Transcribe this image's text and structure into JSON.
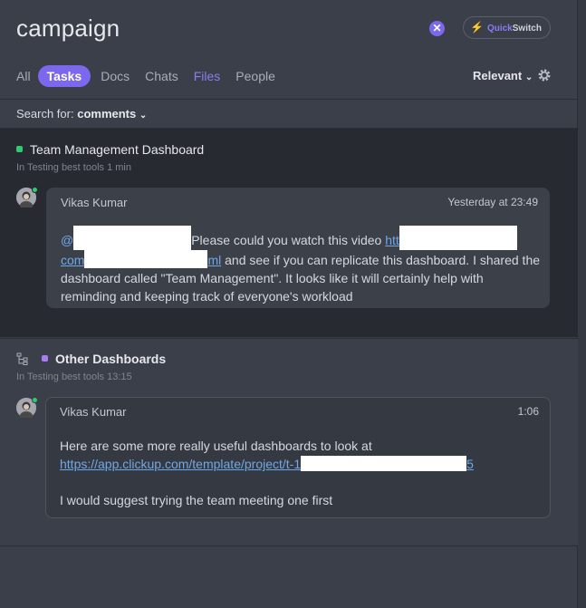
{
  "search": {
    "query": "campaign"
  },
  "quickswitch": {
    "part1": "Quick",
    "part2": "Switch"
  },
  "tabs": [
    "All",
    "Tasks",
    "Docs",
    "Chats",
    "Files",
    "People"
  ],
  "sort": {
    "label": "Relevant"
  },
  "search_for": {
    "prefix": "Search for:",
    "value": "comments"
  },
  "results": [
    {
      "task": "Team Management Dashboard",
      "dot_color": "#2ecc71",
      "location": "In Testing best tools",
      "age": "1 min",
      "comment": {
        "author": "Vikas Kumar",
        "time": "Yesterday at 23:49",
        "mention": "@",
        "text1": "Please could you watch this video ",
        "link1a": "htt",
        "link1b": "com",
        "link1c": "ml",
        "text2": " and see if you can replicate this dashboard. I shared the dashboard called \"Team Management\". It looks like it will certainly help with reminding and keeping track of everyone's workload"
      }
    },
    {
      "task": "Other Dashboards",
      "dot_color": "#a77cf5",
      "location": "In Testing best tools",
      "age": "13:15",
      "comment": {
        "author": "Vikas Kumar",
        "time": "1:06",
        "line1": "Here are some more really useful dashboards to look at",
        "link_start": "https://app.clickup.com/template/project/t-1",
        "link_end": "5",
        "line3": "I would suggest trying the team meeting one first"
      }
    }
  ],
  "colors": {
    "accent": "#7b68ee",
    "link": "#6fa8e8",
    "online": "#2ecc71"
  }
}
